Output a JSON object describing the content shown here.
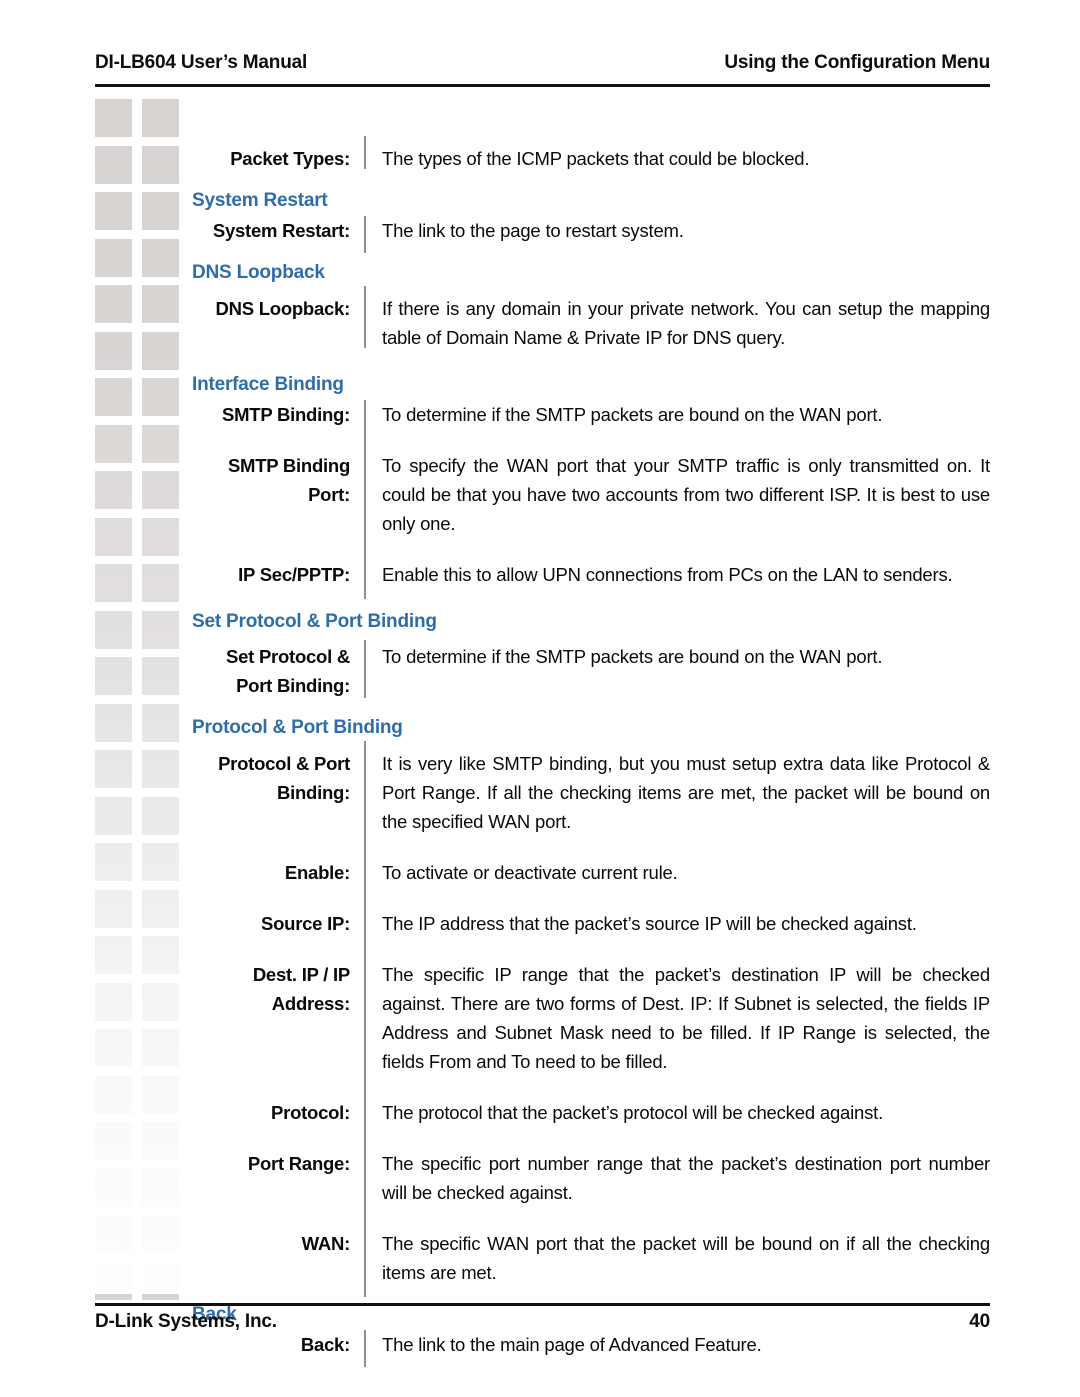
{
  "header": {
    "left": "DI-LB604 User’s Manual",
    "right": "Using the Configuration Menu"
  },
  "footer": {
    "company": "D-Link Systems, Inc.",
    "page_number": "40"
  },
  "colors": {
    "heading_blue": "#2E6DA8",
    "body_text": "#0A0A0A",
    "rule_black": "#111111",
    "divider_gray": "#8E8E8E",
    "decor_square": "#D6D3D1"
  },
  "decor": {
    "square_count_per_column": 26,
    "columns": 2
  },
  "body": {
    "blocks": [
      {
        "kind": "entry",
        "label": "Packet Types:",
        "description": "The types of the ICMP packets that could be blocked."
      },
      {
        "kind": "section",
        "heading": "System Restart"
      },
      {
        "kind": "entry",
        "label": "System Restart:",
        "description": "The link to the page to restart system."
      },
      {
        "kind": "section",
        "heading": "DNS Loopback"
      },
      {
        "kind": "entry",
        "label": "DNS Loopback:",
        "description": "If there is any domain in your private network. You can setup the mapping table of Domain Name & Private IP for DNS query."
      },
      {
        "kind": "section",
        "heading": "Interface Binding"
      },
      {
        "kind": "entry",
        "label": "SMTP Binding:",
        "description": "To determine if the SMTP packets are bound on the WAN port."
      },
      {
        "kind": "entry",
        "label": "SMTP Binding Port:",
        "description": "To specify the WAN port that your SMTP traffic is only transmitted on. It could be that you have two accounts from two different ISP. It is best to use only one."
      },
      {
        "kind": "entry",
        "label": "IP Sec/PPTP:",
        "description": "Enable this to allow UPN connections from PCs on the LAN to senders."
      },
      {
        "kind": "section",
        "heading": "Set Protocol & Port Binding"
      },
      {
        "kind": "entry",
        "label": "Set Protocol & Port Binding:",
        "description": "To determine if the SMTP packets are bound on the WAN port."
      },
      {
        "kind": "section",
        "heading": "Protocol & Port Binding"
      },
      {
        "kind": "entry",
        "label": "Protocol & Port Binding:",
        "description": "It is very like SMTP binding, but you must setup extra data like Protocol & Port Range. If all the checking items are met, the packet will be bound on the specified WAN port."
      },
      {
        "kind": "entry",
        "label": "Enable:",
        "description": "To activate or deactivate current rule."
      },
      {
        "kind": "entry",
        "label": "Source IP:",
        "description": "The IP address that the packet’s source IP will be checked against."
      },
      {
        "kind": "entry",
        "label": "Dest. IP / IP Address:",
        "description": "The specific IP range that the packet’s destination IP will be checked against. There are two forms of Dest. IP: If Subnet is selected, the fields IP Address and Subnet Mask need to be filled. If IP Range is selected, the fields From and To need to be filled."
      },
      {
        "kind": "entry",
        "label": "Protocol:",
        "description": "The protocol that the packet’s protocol will be checked against."
      },
      {
        "kind": "entry",
        "label": "Port Range:",
        "description": "The specific port number range that the packet’s destination port number will be checked against."
      },
      {
        "kind": "entry",
        "label": "WAN:",
        "description": "The specific WAN port that the packet will be bound on if all the checking items are met."
      },
      {
        "kind": "section",
        "heading": "Back"
      },
      {
        "kind": "entry",
        "label": "Back:",
        "description": "The link to the main page of Advanced Feature."
      }
    ]
  }
}
